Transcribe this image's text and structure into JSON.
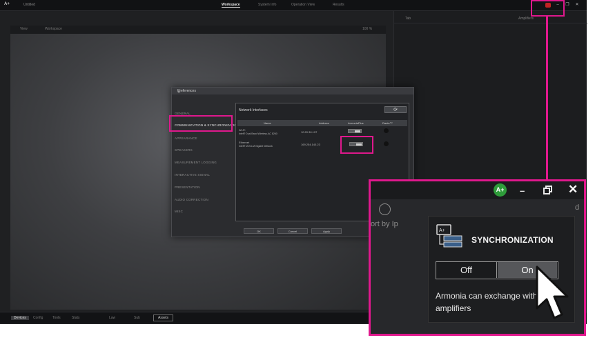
{
  "colors": {
    "highlight": "#e0188d",
    "app_bg": "#1f2022",
    "badge_green": "#2e9b3a",
    "sync_red": "#c02323"
  },
  "topbar": {
    "brand": "A+",
    "app_name": "Untitled",
    "tabs": [
      "Workspace",
      "System Info",
      "Operation View",
      "Results"
    ],
    "window_buttons": [
      "minimize-icon",
      "restore-icon",
      "close-icon"
    ]
  },
  "workspace": {
    "header_left": "View",
    "header_mid": "Workspace",
    "header_right": "100 %"
  },
  "right_panel": {
    "header_left": "Tab",
    "header_right": "Amplifiers"
  },
  "bottombar": {
    "tabs": [
      "Devices",
      "Config",
      "Tools",
      "Stats",
      "Law",
      "Sub"
    ],
    "boxed": "Assets"
  },
  "dialog": {
    "title": "Preferences",
    "nav": [
      "GENERAL",
      "COMMUNICATION & SYNCHRONIZATION",
      "APPEARANCE",
      "SPEAKERS",
      "MEASUREMENT LOGGING",
      "INTERACTIVE SIGNAL",
      "PRESENTATION",
      "AUDIO CORRECTION",
      "MISC"
    ],
    "content_title": "Network Interfaces",
    "columns": [
      "Name",
      "Address",
      "ArmoniaPlus",
      "Dante™"
    ],
    "rows": [
      {
        "name_line1": "Wi-Fi",
        "name_line2": "Intel® Dual Band Wireless-AC 8260",
        "address": "10.20.30.197"
      },
      {
        "name_line1": "Ethernet",
        "name_line2": "Intel® I219-LM Gigabit Network",
        "address": "169.254.140.23"
      }
    ],
    "buttons": [
      "OK",
      "Cancel",
      "Apply"
    ]
  },
  "zoom": {
    "badge": "A+",
    "sort_label": "ort by Ip",
    "edge_label": "d",
    "popup_title": "SYNCHRONIZATION",
    "toggle_off": "Off",
    "toggle_on": "On",
    "toggle_state": "On",
    "description": "Armonia can exchange with the amplifiers"
  }
}
